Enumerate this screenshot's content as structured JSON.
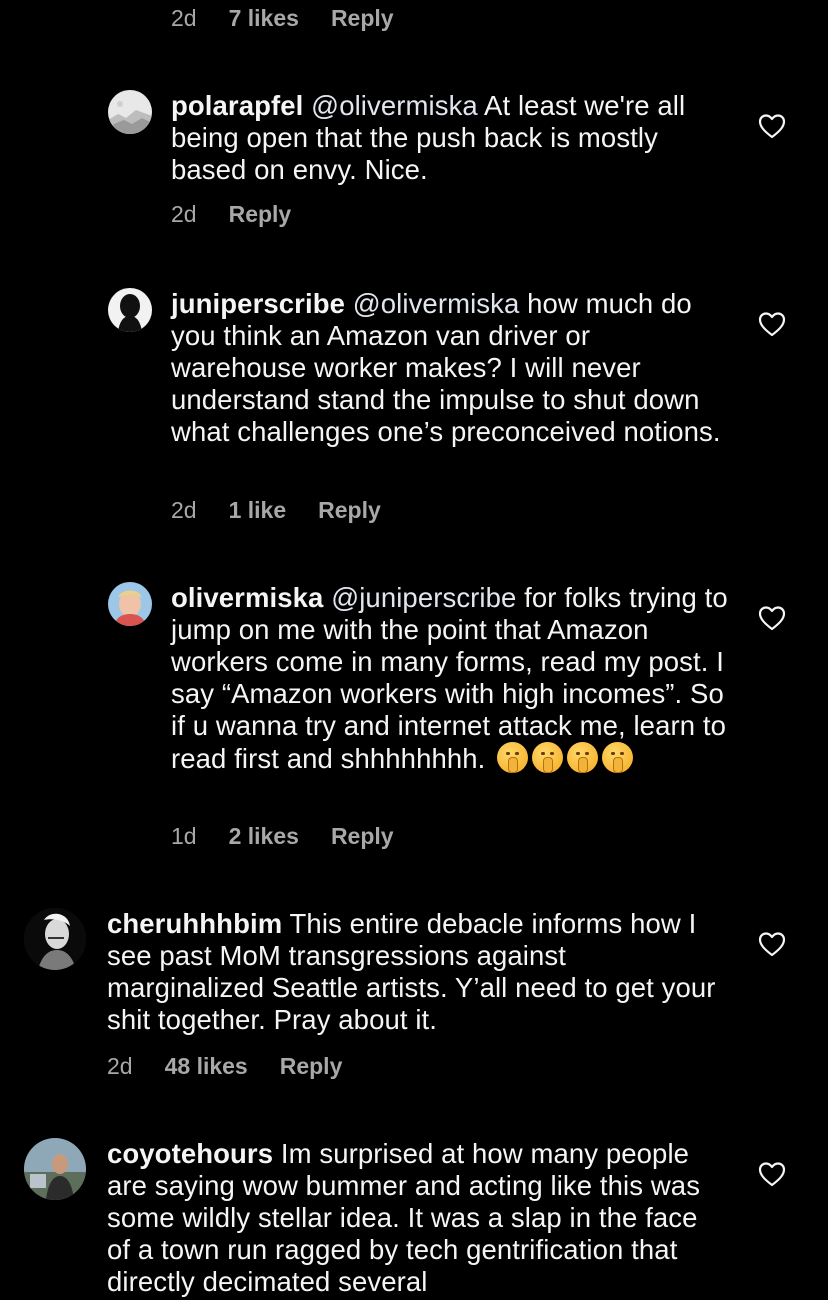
{
  "colors": {
    "background": "#000000",
    "text": "#f5f5f5",
    "meta": "#a8a8a8"
  },
  "top_meta": {
    "time": "2d",
    "likes": "7 likes",
    "reply": "Reply"
  },
  "comments": [
    {
      "username": "polarapfel",
      "mention": "@olivermiska",
      "body": " At least we're all being open that the push back is mostly based on envy. Nice.",
      "time": "2d",
      "likes": "",
      "reply": "Reply",
      "icon": "heart-outline-icon"
    },
    {
      "username": "juniperscribe",
      "mention": "@olivermiska",
      "body": " how much do you think an Amazon van driver or warehouse worker makes? I will never understand stand the impulse to shut down what challenges one’s preconceived notions.",
      "time": "2d",
      "likes": "1 like",
      "reply": "Reply",
      "icon": "heart-outline-icon"
    },
    {
      "username": "olivermiska",
      "mention": "@juniperscribe",
      "body": " for folks trying to jump on me with the point that Amazon workers come in many forms, read my post. I say “Amazon workers with high incomes”. So if u wanna try and internet attack me, learn to read first and shhhhhhhh. ",
      "emoji": "🤫",
      "time": "1d",
      "likes": "2 likes",
      "reply": "Reply",
      "icon": "heart-outline-icon"
    },
    {
      "username": "cheruhhhbim",
      "mention": "",
      "body": " This entire debacle informs how I see past MoM transgressions against marginalized Seattle artists. Y’all need to get your shit together. Pray about it.",
      "time": "2d",
      "likes": "48 likes",
      "reply": "Reply",
      "icon": "heart-outline-icon"
    },
    {
      "username": "coyotehours",
      "mention": "",
      "body": " Im surprised at how many people are saying wow bummer and acting like this was some wildly stellar idea. It was a slap in the face of a town run ragged by tech gentrification that directly decimated several",
      "time": "",
      "likes": "",
      "reply": "",
      "icon": "heart-outline-icon"
    }
  ]
}
